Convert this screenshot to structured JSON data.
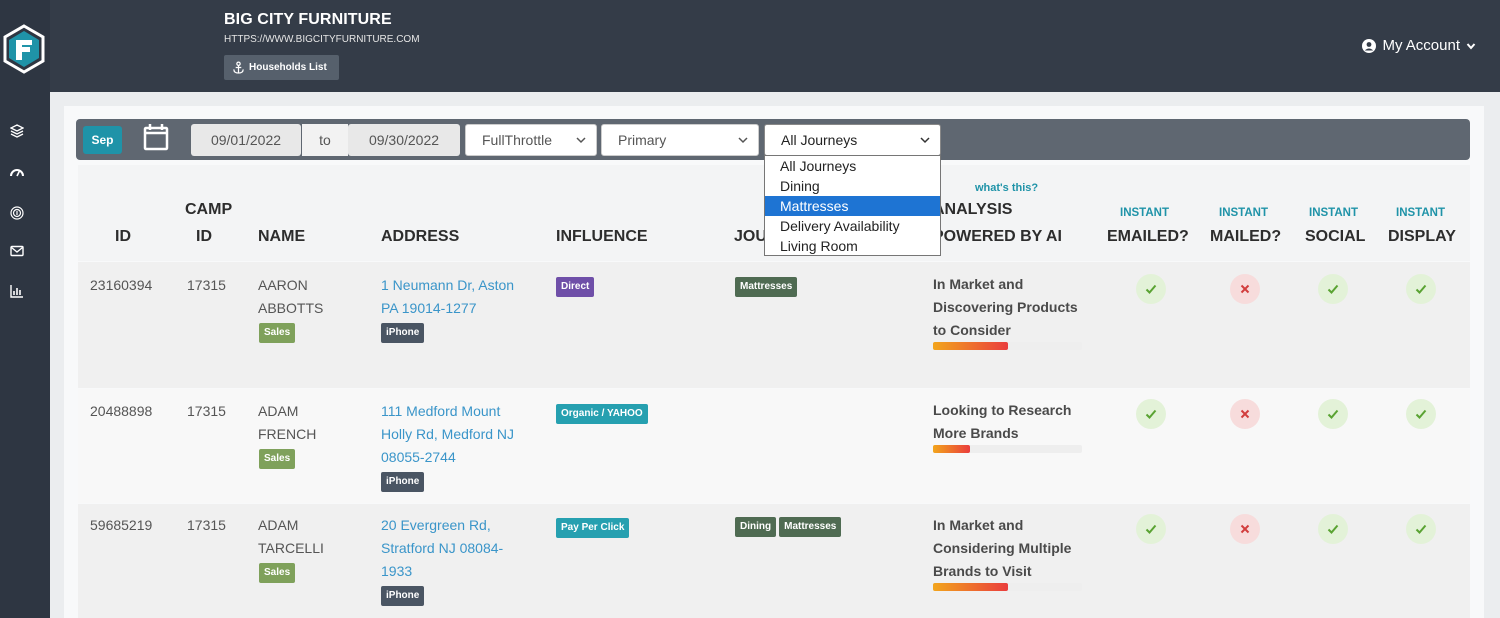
{
  "header": {
    "brand": "BIG CITY FURNITURE",
    "url": "HTTPS://WWW.BIGCITYFURNITURE.COM",
    "households_button": "Households List",
    "account": "My Account"
  },
  "filters": {
    "month": "Sep",
    "date_from": "09/01/2022",
    "to_label": "to",
    "date_to": "09/30/2022",
    "source": "FullThrottle",
    "type": "Primary",
    "journey": "All Journeys",
    "journey_options": [
      "All Journeys",
      "Dining",
      "Mattresses",
      "Delivery Availability",
      "Living Room"
    ],
    "journey_highlighted": "Mattresses"
  },
  "table": {
    "columns": {
      "id": "ID",
      "camp_id_1": "CAMP",
      "camp_id_2": "ID",
      "name": "NAME",
      "address": "ADDRESS",
      "influence": "INFLUENCE",
      "journey": "JOU",
      "whats_this": "what's this?",
      "analysis_1": "ANALYSIS",
      "analysis_2": "POWERED BY AI",
      "emailed_1": "INSTANT",
      "emailed_2": "EMAILED?",
      "mailed_1": "INSTANT",
      "mailed_2": "MAILED?",
      "social_1": "INSTANT",
      "social_2": "SOCIAL",
      "display_1": "INSTANT",
      "display_2": "DISPLAY"
    },
    "rows": [
      {
        "id": "23160394",
        "camp_id": "17315",
        "name_1": "AARON",
        "name_2": "ABBOTTS",
        "role": "Sales",
        "addr_1": "1 Neumann Dr, Aston",
        "addr_2": "PA 19014-1277",
        "addr_3": "",
        "device": "iPhone",
        "influence": "Direct",
        "journeys": [
          "Mattresses"
        ],
        "analysis_1": "In Market and",
        "analysis_2": "Discovering Products",
        "analysis_3": "to Consider",
        "score": 0.5,
        "emailed": "yes",
        "mailed": "no",
        "social": "yes",
        "display": "yes"
      },
      {
        "id": "20488898",
        "camp_id": "17315",
        "name_1": "ADAM",
        "name_2": "FRENCH",
        "role": "Sales",
        "addr_1": "111 Medford Mount",
        "addr_2": "Holly Rd, Medford NJ",
        "addr_3": "08055-2744",
        "device": "iPhone",
        "influence": "Organic / YAHOO",
        "journeys": [],
        "analysis_1": "Looking to Research",
        "analysis_2": "More Brands",
        "analysis_3": "",
        "score": 0.25,
        "emailed": "yes",
        "mailed": "no",
        "social": "yes",
        "display": "yes"
      },
      {
        "id": "59685219",
        "camp_id": "17315",
        "name_1": "ADAM",
        "name_2": "TARCELLI",
        "role": "Sales",
        "addr_1": "20 Evergreen Rd,",
        "addr_2": "Stratford NJ 08084-",
        "addr_3": "1933",
        "device": "iPhone",
        "influence": "Pay Per Click",
        "journeys": [
          "Dining",
          "Mattresses"
        ],
        "analysis_1": "In Market and",
        "analysis_2": "Considering Multiple",
        "analysis_3": "Brands to Visit",
        "score": 0.5,
        "emailed": "yes",
        "mailed": "no",
        "social": "yes",
        "display": "yes"
      }
    ]
  },
  "colors": {
    "sidebar": "#2e3642",
    "header": "#343c48",
    "accent": "#1f93a8",
    "link": "#3a95c9",
    "selected_option": "#1e74d3"
  },
  "icons": [
    "logo-icon",
    "layers-icon",
    "gauge-icon",
    "fingerprint-icon",
    "mail-icon",
    "chart-icon",
    "calendar-icon",
    "user-circle-icon",
    "chevron-down-icon",
    "anchor-icon",
    "check-icon",
    "x-icon"
  ]
}
